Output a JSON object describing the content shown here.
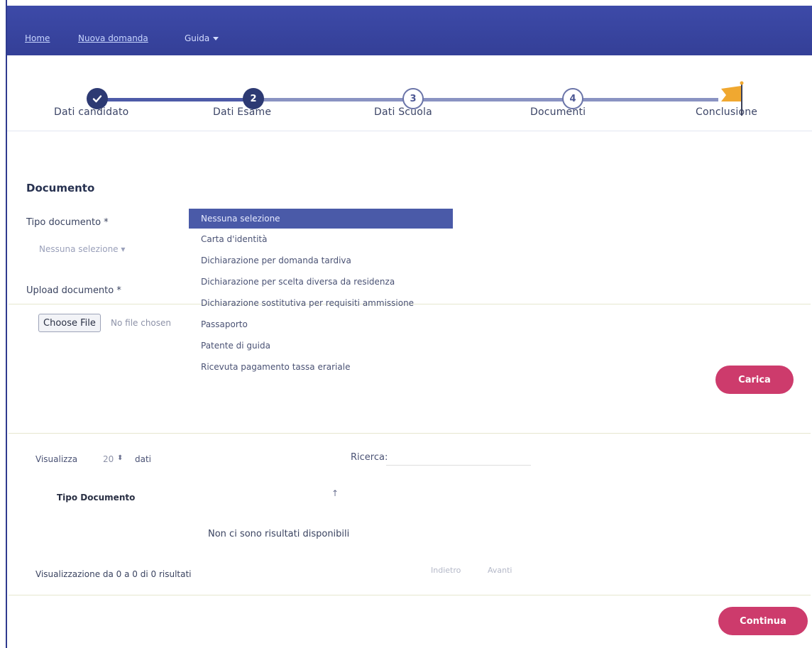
{
  "nav": {
    "home": "Home",
    "new_application": "Nuova domanda",
    "guide": "Guida"
  },
  "stepper": {
    "steps": [
      {
        "label": "Dati candidato",
        "status": "done"
      },
      {
        "label": "Dati Esame",
        "number": "2",
        "status": "active"
      },
      {
        "label": "Dati Scuola",
        "number": "3",
        "status": "todo"
      },
      {
        "label": "Documenti",
        "number": "4",
        "status": "todo"
      },
      {
        "label": "Conclusione",
        "status": "final"
      }
    ]
  },
  "document": {
    "title": "Documento",
    "type_label": "Tipo documento *",
    "type_placeholder": "Nessuna selezione",
    "upload_label": "Upload documento *",
    "file_button": "Choose File",
    "file_status": "No file chosen",
    "options": [
      "Nessuna selezione",
      "Carta d'identità",
      "Dichiarazione per domanda tardiva",
      "Dichiarazione per scelta diversa da residenza",
      "Dichiarazione sostitutiva per requisiti ammissione",
      "Passaporto",
      "Patente di guida",
      "Ricevuta pagamento tassa erariale"
    ],
    "upload_button": "Carica"
  },
  "table": {
    "show_label": "Visualizza",
    "page_size": "20",
    "show_suffix": "dati",
    "search_label": "Ricerca:",
    "column_header": "Tipo Documento",
    "empty_text": "Non ci sono risultati disponibili",
    "summary": "Visualizzazione da 0 a 0 di 0 risultati",
    "prev": "Indietro",
    "next": "Avanti"
  },
  "continue_button": "Continua",
  "colors": {
    "nav_bar": "#3d4aa8",
    "step_active": "#2d3a73",
    "selected_option": "#4a5aa8",
    "accent_button": "#cd3b6c",
    "flag": "#f0a830"
  }
}
